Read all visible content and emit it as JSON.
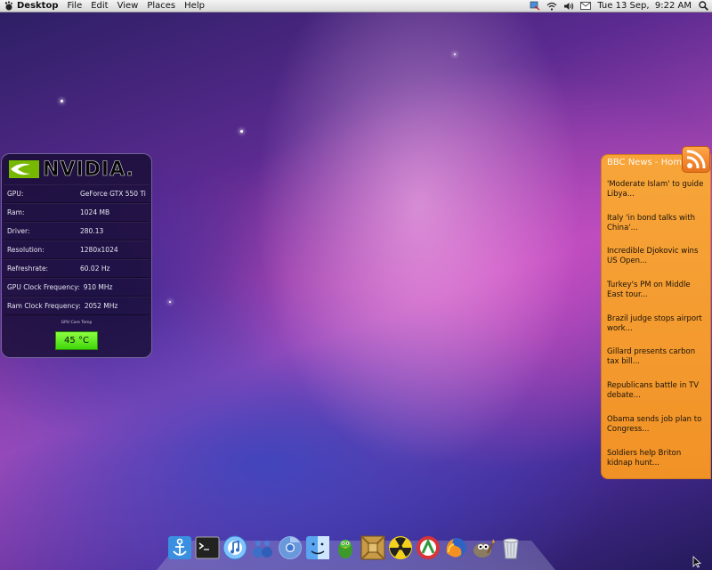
{
  "menubar": {
    "app_name": "Desktop",
    "menus": [
      "File",
      "Edit",
      "View",
      "Places",
      "Help"
    ],
    "clock": "Tue 13 Sep,  9:22 AM"
  },
  "nvidia_widget": {
    "brand": "NVIDIA.",
    "rows": [
      {
        "label": "GPU:",
        "value": "GeForce GTX 550 Ti"
      },
      {
        "label": "Ram:",
        "value": "1024 MB"
      },
      {
        "label": "Driver:",
        "value": "280.13"
      },
      {
        "label": "Resolution:",
        "value": "1280x1024"
      },
      {
        "label": "Refreshrate:",
        "value": "60.02 Hz"
      },
      {
        "label": "GPU Clock Frequency:",
        "value": "910 MHz"
      },
      {
        "label": "Ram Clock Frequency:",
        "value": "2052 MHz"
      }
    ],
    "temp_label": "GPU Core Temp",
    "temp_value": "45 °C"
  },
  "rss_widget": {
    "title": "BBC News - Home",
    "items": [
      "'Moderate Islam' to  guide Libya...",
      "Italy 'in bond talks  with China'...",
      "Incredible Djokovic  wins US Open...",
      "Turkey's PM on Middle  East tour...",
      "Brazil judge stops  airport work...",
      "Gillard presents  carbon tax bill...",
      "Republicans battle in  TV debate...",
      "Obama sends job plan  to Congress...",
      "Soldiers help Briton  kidnap hunt..."
    ]
  },
  "dock": {
    "items": [
      {
        "name": "anchor-app-icon"
      },
      {
        "name": "terminal-icon"
      },
      {
        "name": "music-player-icon"
      },
      {
        "name": "messenger-icon"
      },
      {
        "name": "chromium-icon"
      },
      {
        "name": "finder-icon"
      },
      {
        "name": "pidgin-icon"
      },
      {
        "name": "game-crate-icon"
      },
      {
        "name": "radiation-icon"
      },
      {
        "name": "system-monitor-icon"
      },
      {
        "name": "firefox-icon"
      },
      {
        "name": "gimp-icon"
      },
      {
        "name": "trash-icon"
      }
    ]
  },
  "colors": {
    "rss_background": "#f39a2c",
    "nvidia_green": "#76b900",
    "temp_green": "#5ee620"
  }
}
